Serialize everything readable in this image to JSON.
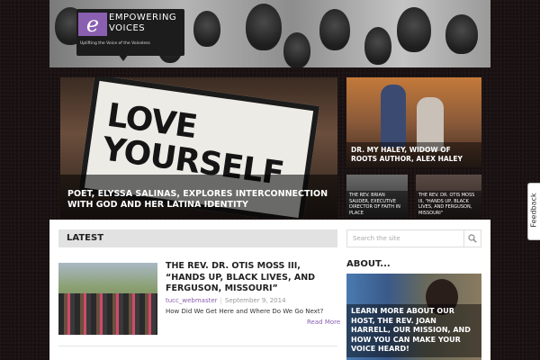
{
  "header": {
    "logo_line1": "EMPOWERING",
    "logo_line2": "VOICES",
    "logo_tagline": "Uplifting the Voice of the Voiceless"
  },
  "hero": {
    "sign_text": "LOVE YOURSELF",
    "caption": "POET, ELYSSA SALINAS, EXPLORES INTERCONNECTION WITH GOD AND HER LATINA IDENTITY"
  },
  "tiles": [
    {
      "caption": "DR. MY HALEY, WIDOW OF ROOTS AUTHOR, ALEX HALEY"
    },
    {
      "caption": "THE REV. BRIAN SAUDER, EXECUTIVE DIRECTOR OF FAITH IN PLACE"
    },
    {
      "caption": "THE REV. DR. OTIS MOSS III, \"HANDS UP, BLACK LIVES, AND FERGUSON, MISSOURI\""
    }
  ],
  "latest": {
    "label": "LATEST",
    "post": {
      "title": "THE REV. DR. OTIS MOSS III, “HANDS UP, BLACK LIVES, AND FERGUSON, MISSOURI”",
      "author": "tucc_webmaster",
      "date": "September 9, 2014",
      "excerpt": "How Did We Get Here and Where Do We Go Next?",
      "read_more": "Read More"
    }
  },
  "search": {
    "placeholder": "Search the site"
  },
  "about": {
    "heading": "ABOUT...",
    "caption": "LEARN MORE ABOUT OUR HOST, THE REV. JOAN HARRELL, OUR MISSION, AND HOW YOU CAN MAKE YOUR VOICE HEARD!"
  },
  "feedback": {
    "label": "Feedback"
  },
  "colors": {
    "accent": "#8a5fb0",
    "latest_bar": "#e2e2e2"
  }
}
